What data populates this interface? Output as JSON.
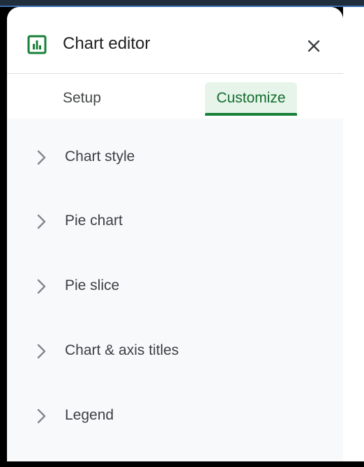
{
  "header": {
    "title": "Chart editor",
    "icon": "bar-chart-icon",
    "close_icon": "close-icon",
    "accent": "#188038"
  },
  "tabs": [
    {
      "label": "Setup",
      "active": false
    },
    {
      "label": "Customize",
      "active": true
    }
  ],
  "sections": [
    {
      "label": "Chart style",
      "icon": "chevron-right-icon"
    },
    {
      "label": "Pie chart",
      "icon": "chevron-right-icon"
    },
    {
      "label": "Pie slice",
      "icon": "chevron-right-icon"
    },
    {
      "label": "Chart & axis titles",
      "icon": "chevron-right-icon"
    },
    {
      "label": "Legend",
      "icon": "chevron-right-icon"
    }
  ]
}
